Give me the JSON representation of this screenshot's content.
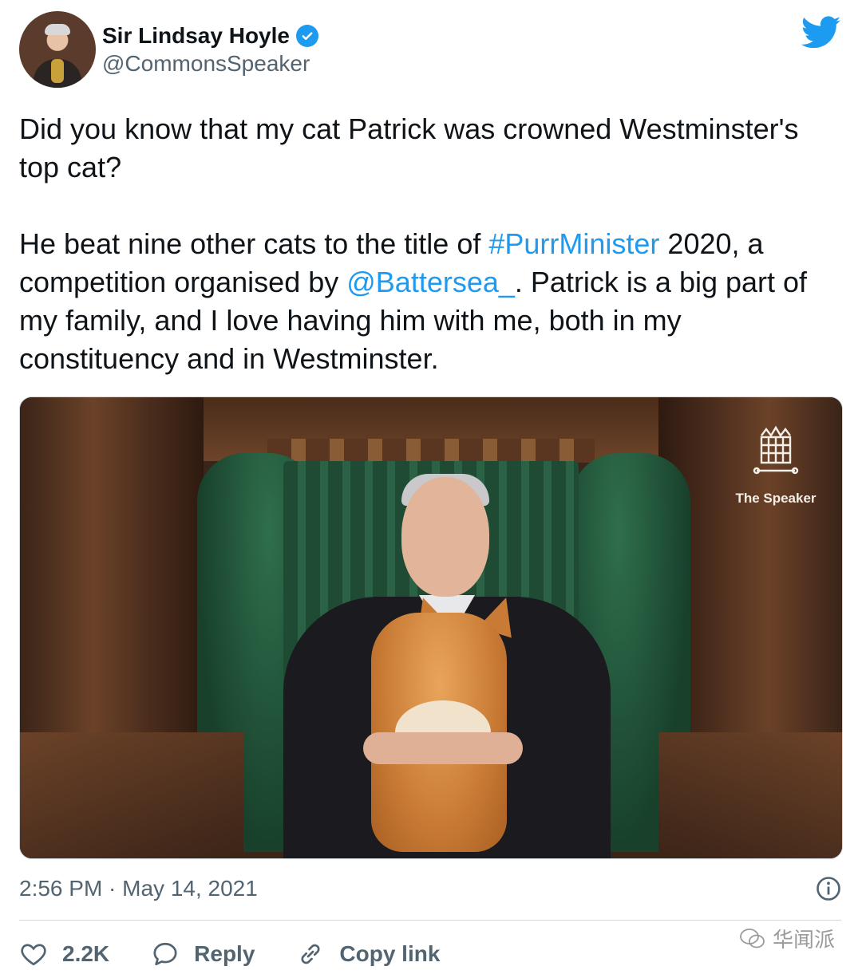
{
  "author": {
    "display_name": "Sir Lindsay Hoyle",
    "handle": "@CommonsSpeaker",
    "verified": true
  },
  "tweet": {
    "para1": "Did you know that my cat Patrick was crowned Westminster's top cat?",
    "para2_part1": "He beat nine other cats to the title of ",
    "hashtag": "#PurrMinister",
    "para2_part2": " 2020, a competition organised by ",
    "mention": "@Battersea_",
    "para2_part3": ". Patrick is a big part of my family, and I love having him with me, both in my constituency and in Westminster."
  },
  "media": {
    "brand_label": "The Speaker"
  },
  "meta": {
    "timestamp": "2:56 PM · May 14, 2021"
  },
  "actions": {
    "likes": "2.2K",
    "reply_label": "Reply",
    "copy_link_label": "Copy link"
  },
  "watermark": {
    "text": "华闻派"
  },
  "colors": {
    "link": "#1d9bf0",
    "secondary_text": "#536471",
    "border": "#cfd9de"
  }
}
